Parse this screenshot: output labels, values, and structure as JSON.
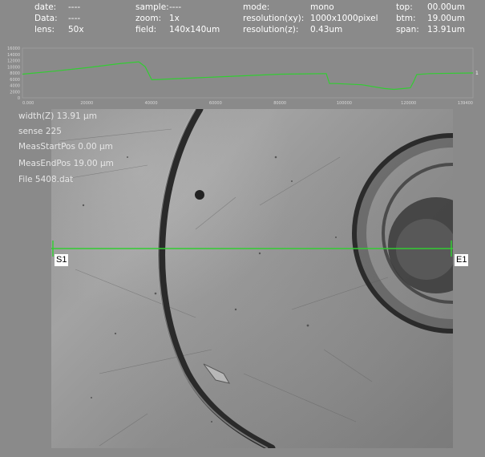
{
  "info": {
    "date_label": "date:",
    "date_value": "----",
    "data_label": "Data:",
    "data_value": "----",
    "lens_label": "lens:",
    "lens_value": "50x",
    "sample_label": "sample:",
    "sample_value": "----",
    "zoom_label": "zoom:",
    "zoom_value": "1x",
    "field_label": "field:",
    "field_value": "140x140um",
    "mode_label": "mode:",
    "mode_value": "mono",
    "resxy_label": "resolution(xy):",
    "resxy_value": "1000x1000pixel",
    "resz_label": "resolution(z):",
    "resz_value": "0.43um",
    "top_label": "top:",
    "top_value": "00.00um",
    "btm_label": "btm:",
    "btm_value": "19.00um",
    "span_label": "span:",
    "span_value": "13.91um"
  },
  "chart_data": {
    "type": "line",
    "y_ticks": [
      "16000",
      "14000",
      "12000",
      "10000",
      "8000",
      "6000",
      "4000",
      "2000",
      "0"
    ],
    "x_ticks": [
      "0.000",
      "20000",
      "40000",
      "60000",
      "80000",
      "100000",
      "120000",
      "139400"
    ],
    "xlim": [
      0,
      139400
    ],
    "ylim": [
      0,
      16000
    ],
    "end_marker": "1",
    "series_color": "#33cc33",
    "x": [
      0,
      10000,
      20000,
      30000,
      36000,
      38000,
      40000,
      60000,
      80000,
      94000,
      95000,
      97000,
      105000,
      112000,
      115000,
      120000,
      121000,
      122000,
      126000,
      139400
    ],
    "values": [
      7600,
      8600,
      9700,
      11000,
      11600,
      10000,
      5800,
      6700,
      7600,
      7800,
      4600,
      4600,
      4200,
      3000,
      2700,
      3200,
      5100,
      7500,
      7800,
      8000
    ],
    "grid": false
  },
  "overlay": {
    "width_text": "width(Z) 13.91 μm",
    "sense_text": "sense 225",
    "start_text": "MeasStartPos 0.00 μm",
    "end_text": "MeasEndPos 19.00 μm",
    "file_text": "File 5408.dat"
  },
  "markers": {
    "start": "S1",
    "end": "E1"
  },
  "colors": {
    "background": "#8a8a8a",
    "text": "#ffffff",
    "scan_line": "#33cc33"
  }
}
